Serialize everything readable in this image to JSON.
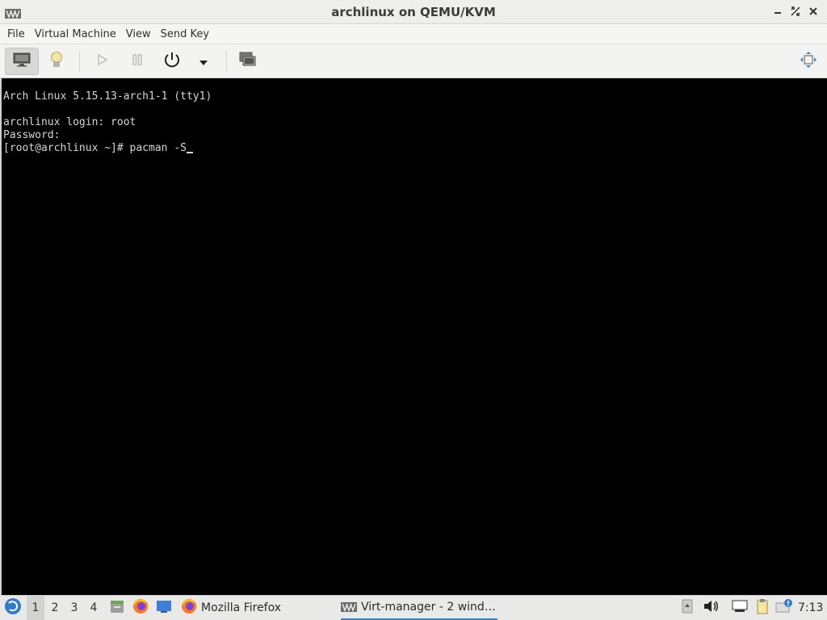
{
  "window": {
    "title": "archlinux on QEMU/KVM",
    "app_icon": "virt-manager-icon",
    "controls": [
      "minimize-icon",
      "restore-icon",
      "close-icon"
    ]
  },
  "menubar": {
    "items": [
      {
        "label": "File"
      },
      {
        "label": "Virtual Machine"
      },
      {
        "label": "View"
      },
      {
        "label": "Send Key"
      }
    ]
  },
  "toolbar": {
    "buttons": [
      {
        "icon": "monitor-icon",
        "active": true
      },
      {
        "icon": "lightbulb-icon",
        "active": false
      },
      {
        "icon": "play-icon",
        "active": false,
        "disabled": true
      },
      {
        "icon": "pause-icon",
        "active": false,
        "disabled": true
      },
      {
        "icon": "power-icon",
        "active": false
      },
      {
        "icon": "chevron-down-icon",
        "active": false
      },
      {
        "icon": "snapshots-icon",
        "active": false
      },
      {
        "icon": "fullscreen-icon",
        "active": false
      }
    ]
  },
  "console": {
    "lines": [
      "Arch Linux 5.15.13-arch1-1 (tty1)",
      "",
      "archlinux login: root",
      "Password:",
      "[root@archlinux ~]# pacman -S"
    ]
  },
  "taskbar": {
    "workspaces": [
      "1",
      "2",
      "3",
      "4"
    ],
    "active_workspace": "1",
    "tasks": [
      {
        "label": "Mozilla Firefox",
        "icon": "firefox-icon"
      },
      {
        "label": "Virt-manager - 2 wind…",
        "icon": "virt-manager-icon",
        "active": true
      }
    ],
    "clock": "7:13",
    "accent": "#3b82c4"
  }
}
